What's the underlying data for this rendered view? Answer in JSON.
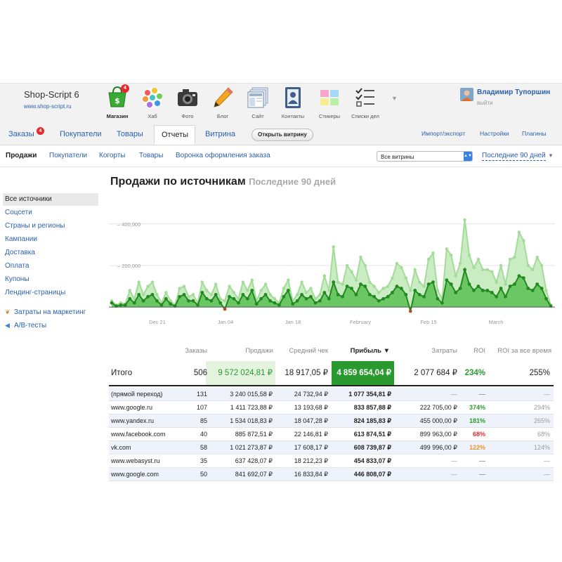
{
  "header": {
    "brand_name": "Shop-Script 6",
    "brand_url": "www.shop-script.ru",
    "apps": [
      {
        "label": "Магазин",
        "icon": "cart-icon",
        "badge": "4"
      },
      {
        "label": "Хаб",
        "icon": "hub-icon"
      },
      {
        "label": "Фото",
        "icon": "camera-icon"
      },
      {
        "label": "Блог",
        "icon": "pencil-icon"
      },
      {
        "label": "Сайт",
        "icon": "site-icon"
      },
      {
        "label": "Контакты",
        "icon": "contacts-icon"
      },
      {
        "label": "Стикеры",
        "icon": "stickers-icon"
      },
      {
        "label": "Списки дел",
        "icon": "checklist-icon"
      }
    ],
    "user": {
      "name": "Владимир Тупоршин",
      "logout": "выйти"
    }
  },
  "tabs": {
    "items": [
      {
        "label": "Заказы",
        "badge": "4"
      },
      {
        "label": "Покупатели"
      },
      {
        "label": "Товары"
      },
      {
        "label": "Отчеты"
      },
      {
        "label": "Витрина"
      }
    ],
    "open_storefront": "Открыть витрину",
    "right": [
      "Импорт/экспорт",
      "Настройки",
      "Плагины"
    ]
  },
  "subnav": {
    "items": [
      "Продажи",
      "Покупатели",
      "Когорты",
      "Товары",
      "Воронка оформления заказа"
    ],
    "storefront_select": "Все витрины",
    "period": "Последние 90 дней"
  },
  "sidebar": {
    "items": [
      "Все источники",
      "Соцсети",
      "Страны и регионы",
      "Кампании",
      "Доставка",
      "Оплата",
      "Купоны",
      "Лендинг-страницы"
    ],
    "extra": [
      "Затраты на маркетинг",
      "A/B-тесты"
    ]
  },
  "page": {
    "title": "Продажи по источникам",
    "subtitle": "Последние 90 дней"
  },
  "chart_data": {
    "type": "area",
    "y_ticks": [
      "200,000",
      "400,000"
    ],
    "x_labels": [
      "Dec 21",
      "Jan 04",
      "Jan 18",
      "February",
      "Feb 15",
      "March"
    ],
    "ylim": [
      -30000,
      450000
    ],
    "grid": true,
    "series": [],
    "sales": [
      30000,
      10000,
      20000,
      15000,
      80000,
      40000,
      120000,
      60000,
      100000,
      120000,
      60000,
      20000,
      70000,
      30000,
      10000,
      90000,
      100000,
      50000,
      60000,
      20000,
      120000,
      80000,
      60000,
      110000,
      40000,
      30000,
      100000,
      70000,
      40000,
      120000,
      80000,
      130000,
      30000,
      80000,
      110000,
      60000,
      40000,
      20000,
      90000,
      130000,
      30000,
      60000,
      120000,
      70000,
      90000,
      40000,
      60000,
      150000,
      80000,
      290000,
      120000,
      110000,
      200000,
      170000,
      130000,
      240000,
      200000,
      120000,
      100000,
      70000,
      90000,
      100000,
      140000,
      210000,
      190000,
      140000,
      80000,
      180000,
      120000,
      100000,
      230000,
      260000,
      80000,
      40000,
      280000,
      250000,
      150000,
      210000,
      420000,
      250000,
      190000,
      230000,
      180000,
      180000,
      170000,
      120000,
      200000,
      110000,
      230000,
      240000,
      360000,
      320000,
      200000,
      180000,
      240000,
      200000,
      80000,
      10000
    ],
    "profit": [
      20000,
      5000,
      10000,
      10000,
      40000,
      20000,
      60000,
      30000,
      50000,
      60000,
      30000,
      10000,
      40000,
      15000,
      5000,
      50000,
      60000,
      30000,
      30000,
      10000,
      70000,
      40000,
      30000,
      60000,
      20000,
      -10000,
      50000,
      40000,
      20000,
      60000,
      40000,
      80000,
      15000,
      40000,
      60000,
      30000,
      20000,
      10000,
      50000,
      80000,
      15000,
      30000,
      60000,
      40000,
      50000,
      20000,
      30000,
      70000,
      40000,
      120000,
      60000,
      50000,
      100000,
      90000,
      60000,
      110000,
      100000,
      60000,
      50000,
      30000,
      40000,
      50000,
      70000,
      100000,
      90000,
      60000,
      -20000,
      80000,
      60000,
      50000,
      110000,
      120000,
      40000,
      20000,
      130000,
      110000,
      70000,
      90000,
      180000,
      110000,
      80000,
      100000,
      80000,
      80000,
      70000,
      50000,
      90000,
      50000,
      100000,
      110000,
      150000,
      140000,
      90000,
      80000,
      110000,
      90000,
      40000,
      5000
    ]
  },
  "table": {
    "headers": [
      "Заказы",
      "Продажи",
      "Средний чек",
      "Прибыль ▼",
      "Затраты",
      "ROI",
      "ROI за все время"
    ],
    "total": {
      "label": "Итого",
      "orders": "506",
      "sales": "9 572 024,81 ₽",
      "avg": "18 917,05 ₽",
      "profit": "4 859 654,04 ₽",
      "costs": "2 077 684 ₽",
      "roi": "234%",
      "roi_all": "255%"
    },
    "rows": [
      {
        "name": "(прямой переход)",
        "orders": "131",
        "sales": "3 240 015,58 ₽",
        "avg": "24 732,94 ₽",
        "profit": "1 077 354,81 ₽",
        "costs": "—",
        "roi": "—",
        "roi_all": "—"
      },
      {
        "name": "www.google.ru",
        "orders": "107",
        "sales": "1 411 723,88 ₽",
        "avg": "13 193,68 ₽",
        "profit": "833 857,88 ₽",
        "costs": "222 705,00 ₽",
        "roi": "374%",
        "roi_all": "294%",
        "roi_color": "#2a9a2f"
      },
      {
        "name": "www.yandex.ru",
        "orders": "85",
        "sales": "1 534 018,83 ₽",
        "avg": "18 047,28 ₽",
        "profit": "824 185,83 ₽",
        "costs": "455 000,00 ₽",
        "roi": "181%",
        "roi_all": "265%",
        "roi_color": "#2a9a2f"
      },
      {
        "name": "www.facebook.com",
        "orders": "40",
        "sales": "885 872,51 ₽",
        "avg": "22 146,81 ₽",
        "profit": "613 874,51 ₽",
        "costs": "899 963,00 ₽",
        "roi": "68%",
        "roi_all": "68%",
        "roi_color": "#e8282f"
      },
      {
        "name": "vk.com",
        "orders": "58",
        "sales": "1 021 273,87 ₽",
        "avg": "17 608,17 ₽",
        "profit": "608 739,87 ₽",
        "costs": "499 996,00 ₽",
        "roi": "122%",
        "roi_all": "124%",
        "roi_color": "#f0902a"
      },
      {
        "name": "www.webasyst.ru",
        "orders": "35",
        "sales": "637 428,07 ₽",
        "avg": "18 212,23 ₽",
        "profit": "454 833,07 ₽",
        "costs": "—",
        "roi": "—",
        "roi_all": "—"
      },
      {
        "name": "www.google.com",
        "orders": "50",
        "sales": "841 692,07 ₽",
        "avg": "16 833,84 ₽",
        "profit": "446 808,07 ₽",
        "costs": "—",
        "roi": "—",
        "roi_all": "—"
      }
    ]
  },
  "colors": {
    "accent": "#2a5fb0",
    "green": "#2a9a2f",
    "light_green": "#a8dca0",
    "red_badge": "#e8282f"
  }
}
